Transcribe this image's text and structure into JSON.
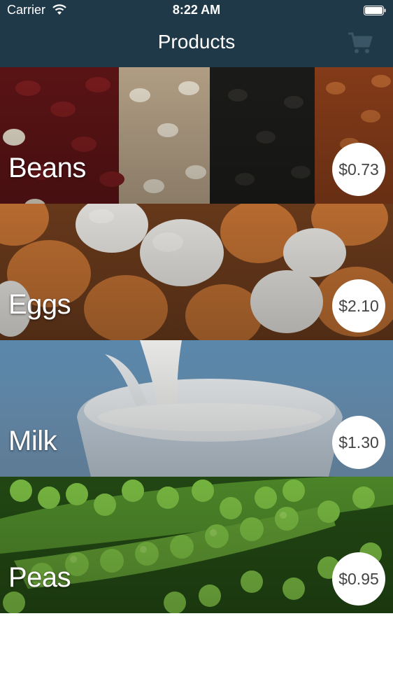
{
  "status_bar": {
    "carrier": "Carrier",
    "time": "8:22 AM"
  },
  "nav": {
    "title": "Products",
    "cart_icon": "cart-icon"
  },
  "products": [
    {
      "name": "Beans",
      "price": "$0.73"
    },
    {
      "name": "Eggs",
      "price": "$2.10"
    },
    {
      "name": "Milk",
      "price": "$1.30"
    },
    {
      "name": "Peas",
      "price": "$0.95"
    }
  ],
  "colors": {
    "nav_bar": "#203949",
    "price_badge": "#ffffff",
    "price_text": "#444444"
  }
}
